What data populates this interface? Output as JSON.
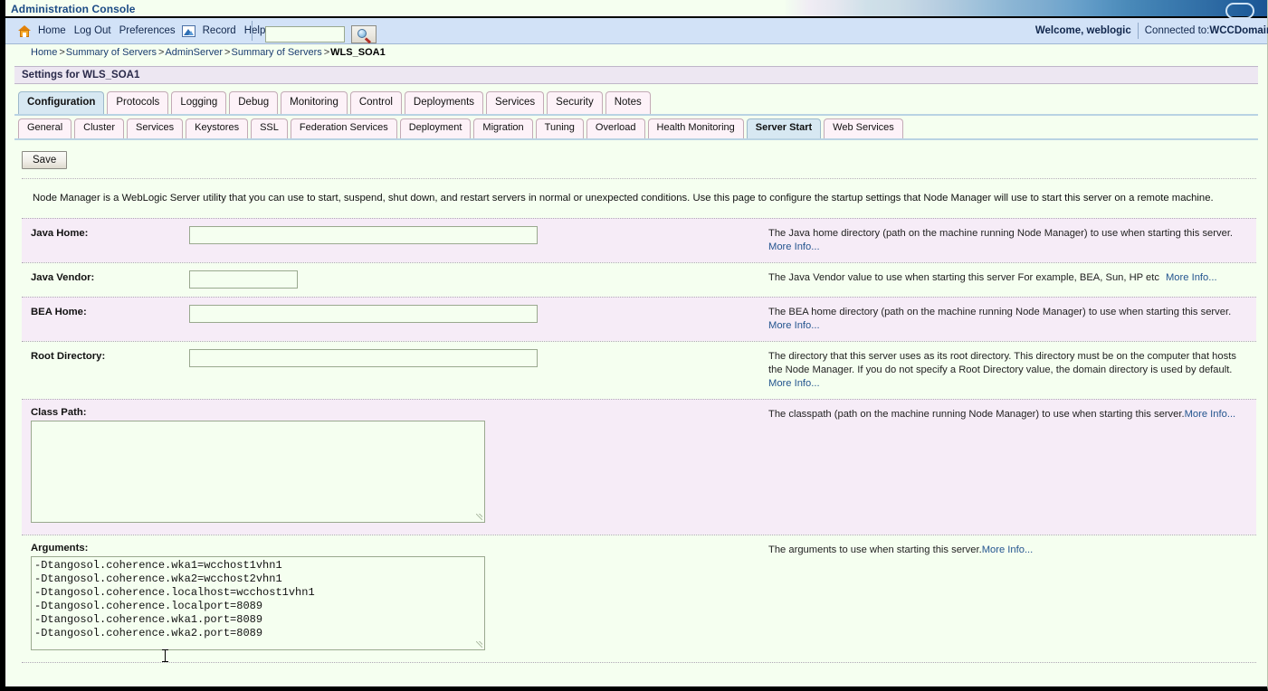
{
  "window": {
    "title": "Administration Console"
  },
  "toolbar": {
    "home": "Home",
    "logout": "Log Out",
    "preferences": "Preferences",
    "record": "Record",
    "help": "Help",
    "search_value": "",
    "search_placeholder": "",
    "welcome": "Welcome, weblogic",
    "connected_label": "Connected to: ",
    "connected_value": "WCCDomain"
  },
  "breadcrumb": {
    "items": [
      "Home",
      "Summary of Servers",
      "AdminServer",
      "Summary of Servers"
    ],
    "current": "WLS_SOA1",
    "separator": ">"
  },
  "settings": {
    "header": "Settings for WLS_SOA1"
  },
  "tabs_primary": [
    {
      "label": "Configuration",
      "active": true
    },
    {
      "label": "Protocols",
      "active": false
    },
    {
      "label": "Logging",
      "active": false
    },
    {
      "label": "Debug",
      "active": false
    },
    {
      "label": "Monitoring",
      "active": false
    },
    {
      "label": "Control",
      "active": false
    },
    {
      "label": "Deployments",
      "active": false
    },
    {
      "label": "Services",
      "active": false
    },
    {
      "label": "Security",
      "active": false
    },
    {
      "label": "Notes",
      "active": false
    }
  ],
  "tabs_secondary": [
    {
      "label": "General",
      "active": false
    },
    {
      "label": "Cluster",
      "active": false
    },
    {
      "label": "Services",
      "active": false
    },
    {
      "label": "Keystores",
      "active": false
    },
    {
      "label": "SSL",
      "active": false
    },
    {
      "label": "Federation Services",
      "active": false
    },
    {
      "label": "Deployment",
      "active": false
    },
    {
      "label": "Migration",
      "active": false
    },
    {
      "label": "Tuning",
      "active": false
    },
    {
      "label": "Overload",
      "active": false
    },
    {
      "label": "Health Monitoring",
      "active": false
    },
    {
      "label": "Server Start",
      "active": true
    },
    {
      "label": "Web Services",
      "active": false
    }
  ],
  "actions": {
    "save": "Save"
  },
  "intro": "Node Manager is a WebLogic Server utility that you can use to start, suspend, shut down, and restart servers in normal or unexpected conditions. Use this page to configure the startup settings that Node Manager will use to start this server on a remote machine.",
  "more_info": "More Info...",
  "fields": {
    "java_home": {
      "label": "Java Home:",
      "value": "",
      "description": "The Java home directory (path on the machine running Node Manager) to use when starting this server."
    },
    "java_vendor": {
      "label": "Java Vendor:",
      "value": "",
      "description": "The Java Vendor value to use when starting this server For example, BEA, Sun, HP etc"
    },
    "bea_home": {
      "label": "BEA Home:",
      "value": "",
      "description": "The BEA home directory (path on the machine running Node Manager) to use when starting this server."
    },
    "root_directory": {
      "label": "Root Directory:",
      "value": "",
      "description": "The directory that this server uses as its root directory. This directory must be on the computer that hosts the Node Manager. If you do not specify a Root Directory value, the domain directory is used by default."
    },
    "class_path": {
      "label": "Class Path:",
      "value": "",
      "description": "The classpath (path on the machine running Node Manager) to use when starting this server."
    },
    "arguments": {
      "label": "Arguments:",
      "value": "-Dtangosol.coherence.wka1=wcchost1vhn1\n-Dtangosol.coherence.wka2=wcchost2vhn1\n-Dtangosol.coherence.localhost=wcchost1vhn1\n-Dtangosol.coherence.localport=8089\n-Dtangosol.coherence.wka1.port=8089\n-Dtangosol.coherence.wka2.port=8089",
      "description": "The arguments to use when starting this server."
    }
  },
  "colors": {
    "header_blue": "#1b4a85",
    "toolbar_bg": "#d2e2f7",
    "row_odd": "#f6ecf7",
    "row_even": "#f5fff0",
    "tab_active": "#d7e8f2",
    "link": "#24558f"
  }
}
